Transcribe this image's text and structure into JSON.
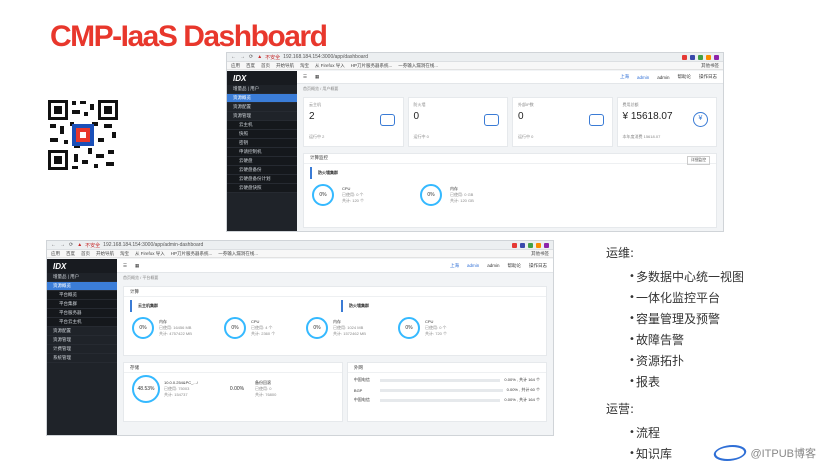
{
  "slide": {
    "title": "CMP-IaaS Dashboard",
    "ops_heading": "运维:",
    "ops_items": [
      "多数据中心统一视图",
      "一体化监控平台",
      "容量管理及预警",
      "故障告警",
      "资源拓扑",
      "报表"
    ],
    "biz_heading": "运营:",
    "biz_items": [
      "流程",
      "知识库"
    ],
    "footer": "@ITPUB博客"
  },
  "screen1": {
    "warn": "不安全",
    "url": "192.168.184.154:3000/app/dashboard",
    "bookmarks": [
      "应用",
      "百度",
      "首页",
      "开始导航",
      "淘宝",
      "从 Firefox 导入",
      "HP刀片服务器系统...",
      "一券输入漏洞在线..."
    ],
    "bookmarks_right": "其他书签",
    "logo": "IDX",
    "nav": [
      {
        "label": "增量品 | 用户",
        "sub": false,
        "active": false
      },
      {
        "label": "资源概览",
        "sub": false,
        "active": true
      },
      {
        "label": "资源配置",
        "sub": false,
        "active": false
      },
      {
        "label": "资源管理",
        "sub": false,
        "active": false
      },
      {
        "label": "云主机",
        "sub": true,
        "active": false
      },
      {
        "label": "快照",
        "sub": true,
        "active": false
      },
      {
        "label": "密钥",
        "sub": true,
        "active": false
      },
      {
        "label": "申请控制机",
        "sub": true,
        "active": false
      },
      {
        "label": "云硬盘",
        "sub": true,
        "active": false
      },
      {
        "label": "云硬盘备份",
        "sub": true,
        "active": false
      },
      {
        "label": "云硬盘备份计划",
        "sub": true,
        "active": false
      },
      {
        "label": "云硬盘快照",
        "sub": true,
        "active": false
      }
    ],
    "top": {
      "region": "上海",
      "user": "admin",
      "user2": "admin",
      "help": "帮助论",
      "logout": "操作日志"
    },
    "crumbs": "首页概览 / 用户概要",
    "cards": [
      {
        "label": "云主机",
        "value": "2",
        "sub": "运行中 2",
        "icon": "cloud-icon"
      },
      {
        "label": "防火墙",
        "value": "0",
        "sub": "运行中 0",
        "icon": "firewall-icon"
      },
      {
        "label": "外部IP数",
        "value": "0",
        "sub": "运行中 0",
        "icon": "ip-icon"
      },
      {
        "label": "费用总额",
        "value": "¥ 15618.07",
        "sub": "本年度消费 15618.07",
        "icon": "yen-icon"
      }
    ],
    "panel_title": "计算监控",
    "panel_btn": "详细监控",
    "section": "防火墙集群",
    "rings": [
      {
        "value": "0%",
        "name": "CPU",
        "used": "已使用: 0 个",
        "total": "共计: 120 个"
      },
      {
        "value": "0%",
        "name": "内存",
        "used": "已使用: 0 GB",
        "total": "共计: 120 GB"
      }
    ]
  },
  "screen2": {
    "warn": "不安全",
    "url": "192.168.184.154:3000/app/admin-dashboard",
    "bookmarks": [
      "应用",
      "百度",
      "首页",
      "开始导航",
      "淘宝",
      "从 Firefox 导入",
      "HP刀片服务器系统...",
      "一券输入漏洞在线..."
    ],
    "bookmarks_right": "其他书签",
    "logo": "IDX",
    "nav": [
      {
        "label": "增量品 | 用户",
        "sub": false,
        "active": false
      },
      {
        "label": "资源概览",
        "sub": false,
        "active": true
      },
      {
        "label": "平台概览",
        "sub": true,
        "active": false
      },
      {
        "label": "平台集群",
        "sub": true,
        "active": false
      },
      {
        "label": "平台服务器",
        "sub": true,
        "active": false
      },
      {
        "label": "平台云主机",
        "sub": true,
        "active": false
      },
      {
        "label": "资源配置",
        "sub": false,
        "active": false
      },
      {
        "label": "资源管理",
        "sub": false,
        "active": false
      },
      {
        "label": "计费管理",
        "sub": false,
        "active": false
      },
      {
        "label": "系统管理",
        "sub": false,
        "active": false
      }
    ],
    "top": {
      "region": "上海",
      "user": "admin",
      "user2": "admin",
      "help": "帮助论",
      "logout": "操作日志"
    },
    "crumbs": "首页概览 / 平台概要",
    "compute_title": "计算",
    "cluster1": "云主机集群",
    "cluster2": "防火墙集群",
    "rings": [
      {
        "value": "0%",
        "name": "内存",
        "used": "已使用: 16456 MB",
        "total": "共计: 4757422 MB"
      },
      {
        "value": "0%",
        "name": "CPU",
        "used": "已使用: 4 个",
        "total": "共计: 2360 个"
      },
      {
        "value": "0%",
        "name": "内存",
        "used": "已使用: 1024 MB",
        "total": "共计: 1572462 MB"
      },
      {
        "value": "0%",
        "name": "CPU",
        "used": "已使用: 0 个",
        "total": "共计: 720 个"
      }
    ],
    "storage_title": "存储",
    "storage_ring": "48.53%",
    "storage_lines": [
      "10.0.0.254&PC_.../",
      "已使用: 75003",
      "共计: 154737"
    ],
    "backup_ring": "0.00%",
    "backup_lines": [
      "备份回滚",
      "已使用: 0",
      "共计: 76800"
    ],
    "net_title": "外网",
    "net_rows": [
      {
        "name": "中国电信",
        "val": "0.00% , 共计 164 个"
      },
      {
        "name": "BGP",
        "val": "0.00% , 共计 60 个"
      },
      {
        "name": "中国电信",
        "val": "0.00% , 共计 164 个"
      }
    ]
  }
}
